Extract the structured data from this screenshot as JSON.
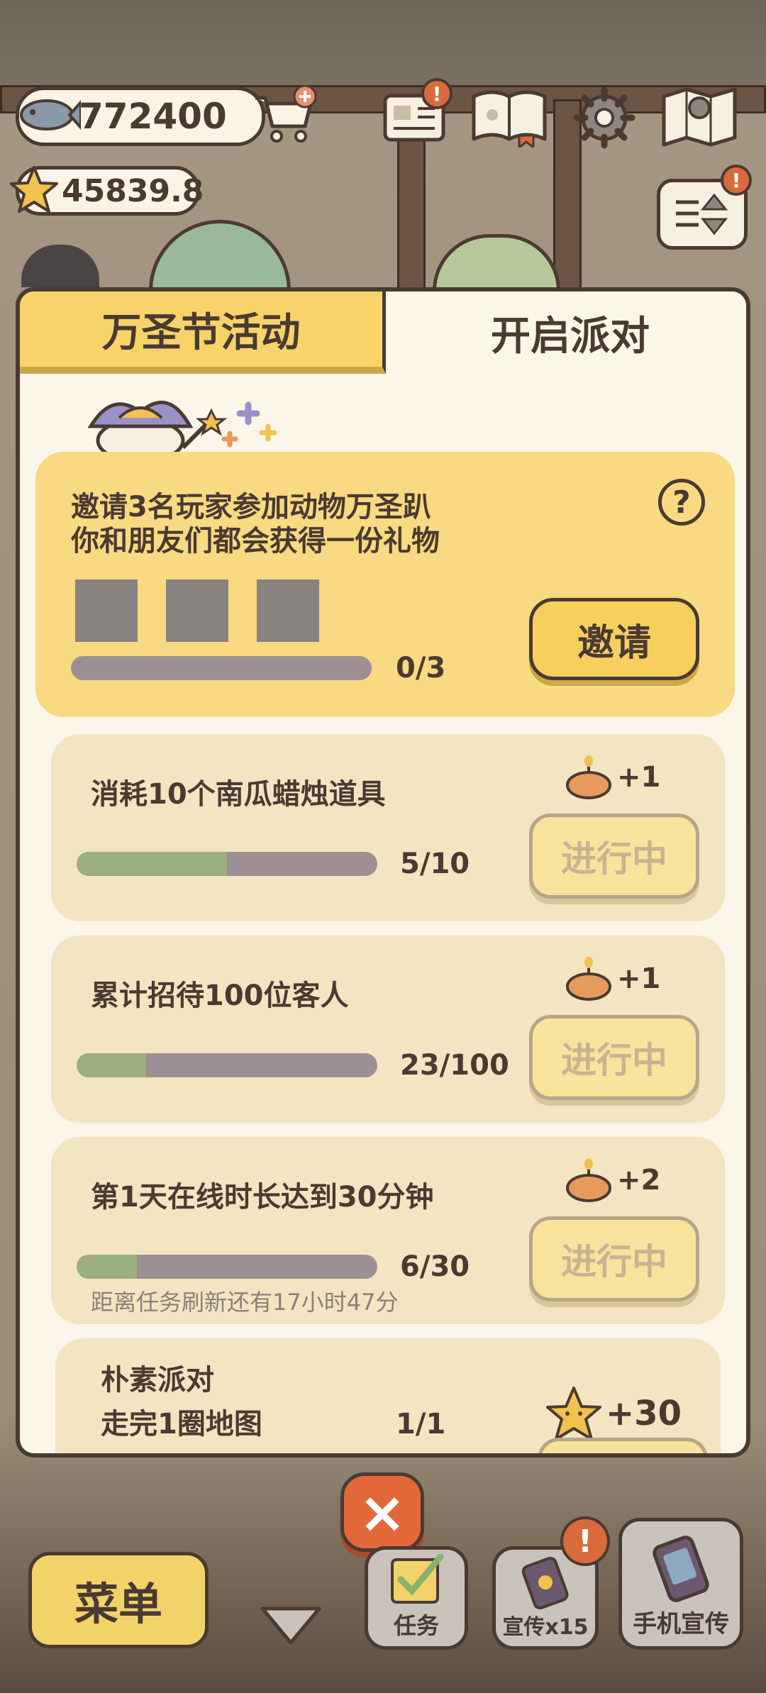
{
  "currency": {
    "fish": "772400",
    "stars": "45839.8"
  },
  "top_icons": [
    "newspaper-icon",
    "guide-book-icon",
    "settings-gear-icon",
    "map-icon",
    "sort-icon"
  ],
  "tabs": {
    "halloween": "万圣节活动",
    "party": "开启派对"
  },
  "invite": {
    "text": "邀请3名玩家参加动物万圣趴\n你和朋友们都会获得一份礼物",
    "help": "?",
    "progress_text": "0/3",
    "progress": 0,
    "button": "邀请"
  },
  "tasks": [
    {
      "title": "消耗10个南瓜蜡烛道具",
      "progress_text": "5/10",
      "progress": 0.5,
      "reward": "+1",
      "status": "进行中"
    },
    {
      "title": "累计招待100位客人",
      "progress_text": "23/100",
      "progress": 0.23,
      "reward": "+1",
      "status": "进行中"
    },
    {
      "title": "第1天在线时长达到30分钟",
      "progress_text": "6/30",
      "progress": 0.2,
      "reward": "+2",
      "status": "进行中",
      "note": "距离任务刷新还有17小时47分"
    },
    {
      "title": "朴素派对\n走完1圈地图",
      "progress_text": "1/1",
      "reward": "+30"
    }
  ],
  "close_label": "×",
  "bottom": {
    "menu": "菜单",
    "tasks": "任务",
    "promo": "宣传x15",
    "phone": "手机宣传"
  },
  "colors": {
    "tab_active": "#f7d36a",
    "card": "#f3e4c2",
    "invite_card": "#f9d981",
    "progress_fill": "#9cb07e",
    "close_btn": "#e2683a"
  }
}
